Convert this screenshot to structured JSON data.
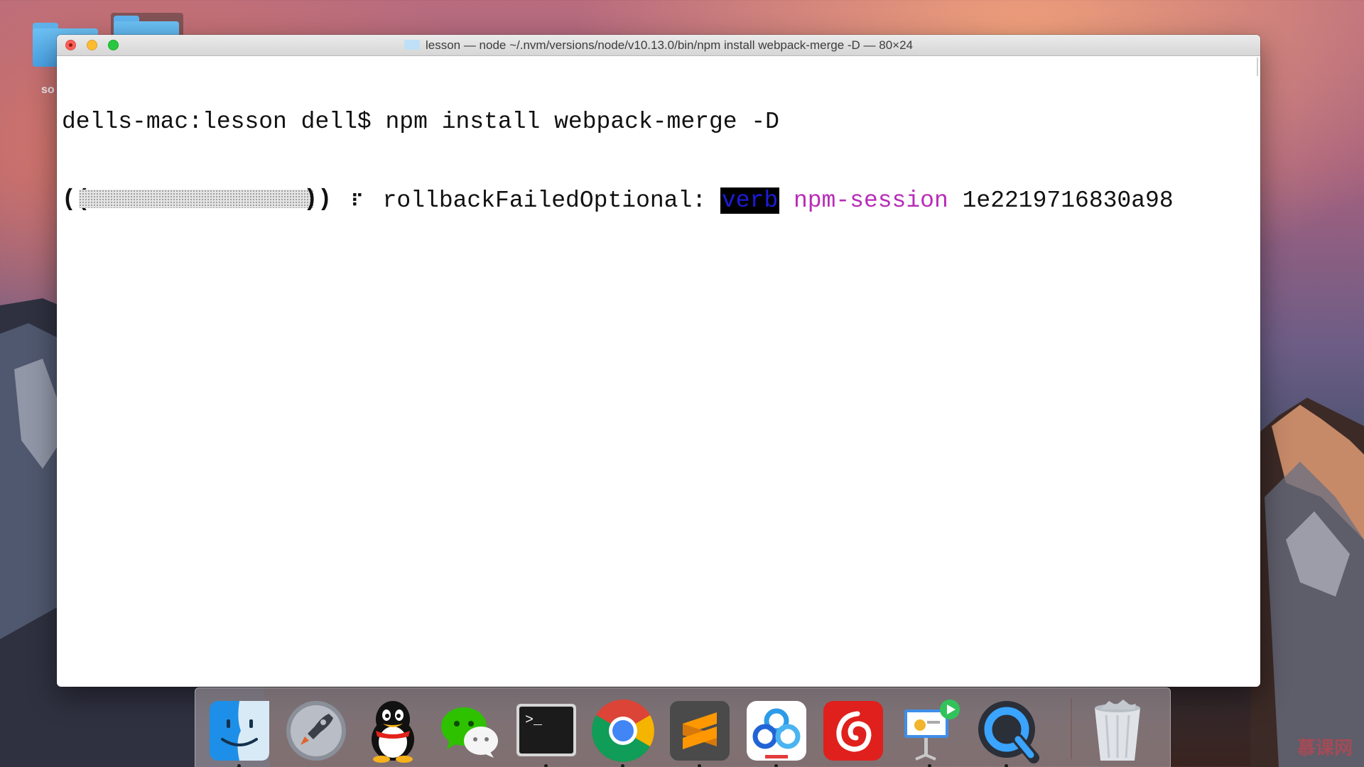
{
  "desktop": {
    "truncated_label": "so"
  },
  "window": {
    "title": "lesson — node ~/.nvm/versions/node/v10.13.0/bin/npm install webpack-merge -D — 80×24"
  },
  "terminal": {
    "prompt": "dells-mac:lesson dell$ ",
    "command": "npm install webpack-merge -D",
    "progress_open": "((",
    "progress_close": "))",
    "progress_fraction": 0.0,
    "spinner": "⠏",
    "stage": " rollbackFailedOptional: ",
    "level": "verb",
    "session_label": "npm-session",
    "session_id": "1e2219716830a98"
  },
  "dock": {
    "apps": [
      "Finder",
      "Launchpad",
      "QQ",
      "WeChat",
      "Terminal",
      "Google Chrome",
      "Sublime Text",
      "Baidu Netdisk",
      "NetEase Cloud Music",
      "Keynote",
      "QuickTime Player",
      "Trash"
    ],
    "terminal_glyph": ">_"
  },
  "watermark": {
    "text": "慕课网"
  },
  "colors": {
    "close": "#fc5f57",
    "minimize": "#fdbc2e",
    "maximize": "#28c840",
    "highlight_bg": "#000000",
    "highlight_fg": "#1c1cd8",
    "magenta": "#b82bb8"
  }
}
